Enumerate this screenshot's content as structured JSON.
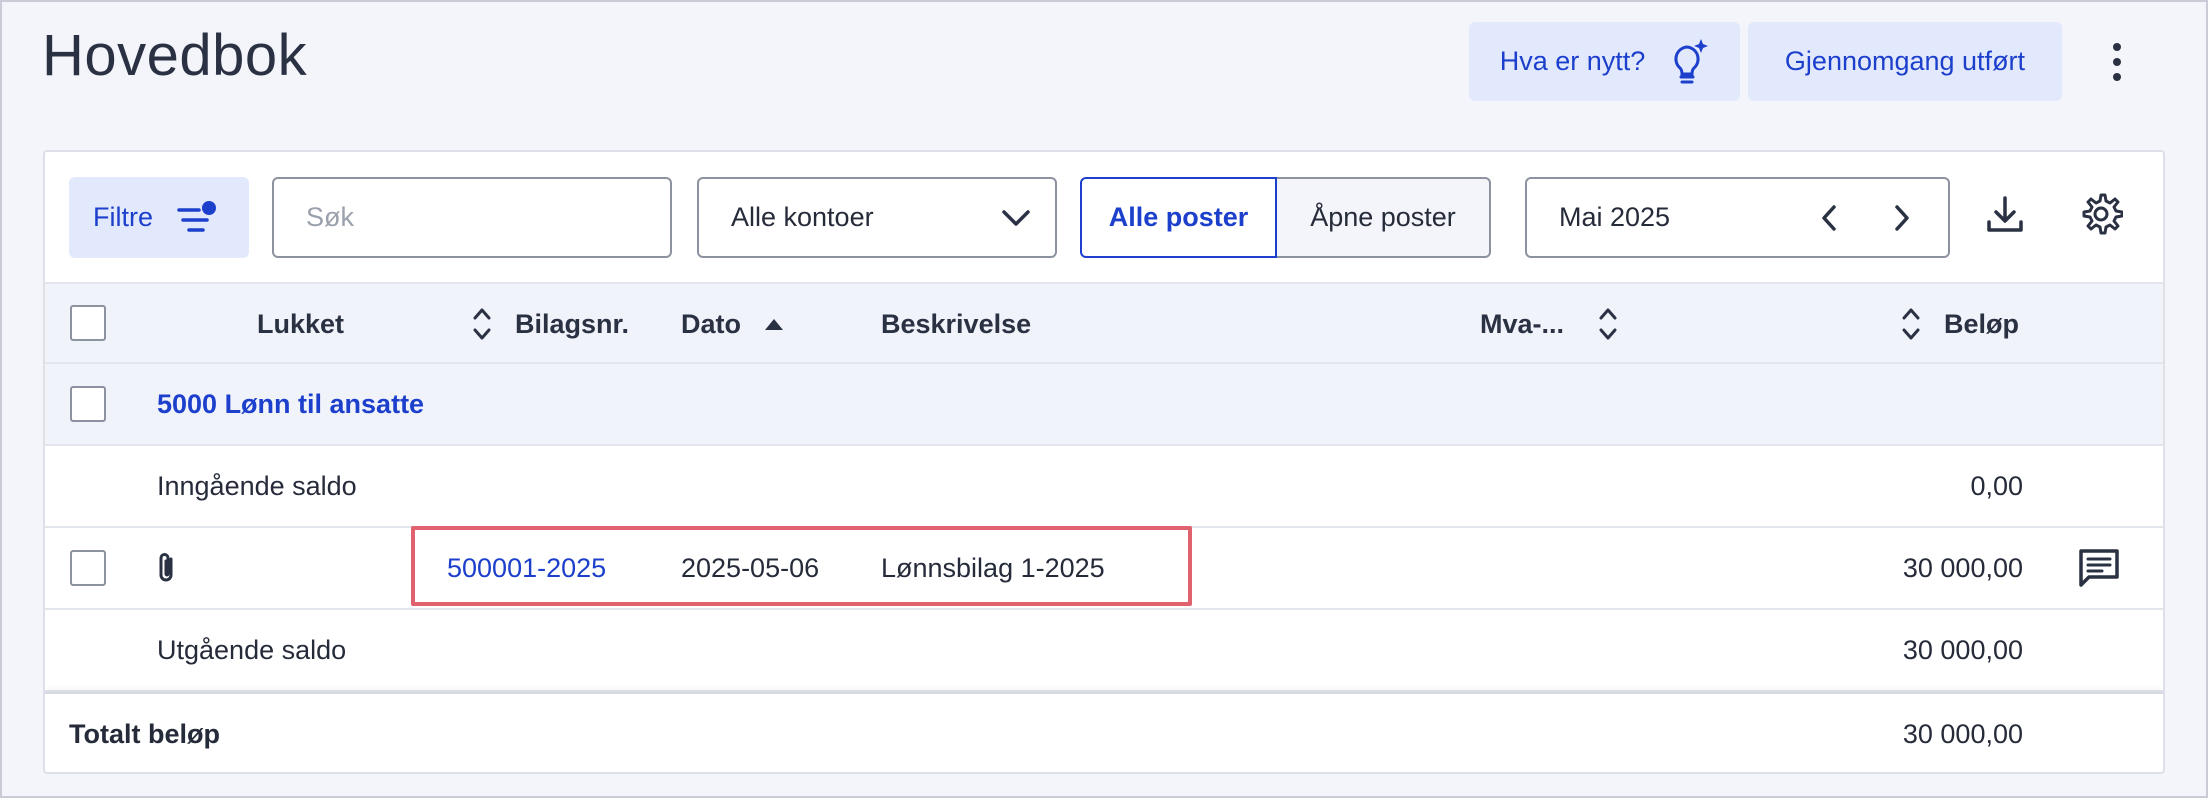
{
  "page": {
    "title": "Hovedbok"
  },
  "header": {
    "whats_new_label": "Hva er nytt?",
    "review_done_label": "Gjennomgang utført"
  },
  "toolbar": {
    "filter_label": "Filtre",
    "search_placeholder": "Søk",
    "accounts_select_value": "Alle kontoer",
    "segment_all_label": "Alle poster",
    "segment_open_label": "Åpne poster",
    "period_value": "Mai 2025"
  },
  "table": {
    "columns": {
      "closed": "Lukket",
      "voucher_no": "Bilagsnr.",
      "date": "Dato",
      "description": "Beskrivelse",
      "vat": "Mva-...",
      "amount": "Beløp"
    },
    "group": {
      "label": "5000 Lønn til ansatte"
    },
    "opening": {
      "label": "Inngående saldo",
      "amount": "0,00"
    },
    "entries": [
      {
        "voucher_no": "500001-2025",
        "date": "2025-05-06",
        "description": "Lønnsbilag 1-2025",
        "amount": "30 000,00"
      }
    ],
    "closing": {
      "label": "Utgående saldo",
      "amount": "30 000,00"
    },
    "total": {
      "label": "Totalt beløp",
      "amount": "30 000,00"
    }
  },
  "colors": {
    "accent": "#1c3fcc",
    "accent_bg": "#e3e9fd",
    "highlight": "#e0626f"
  }
}
